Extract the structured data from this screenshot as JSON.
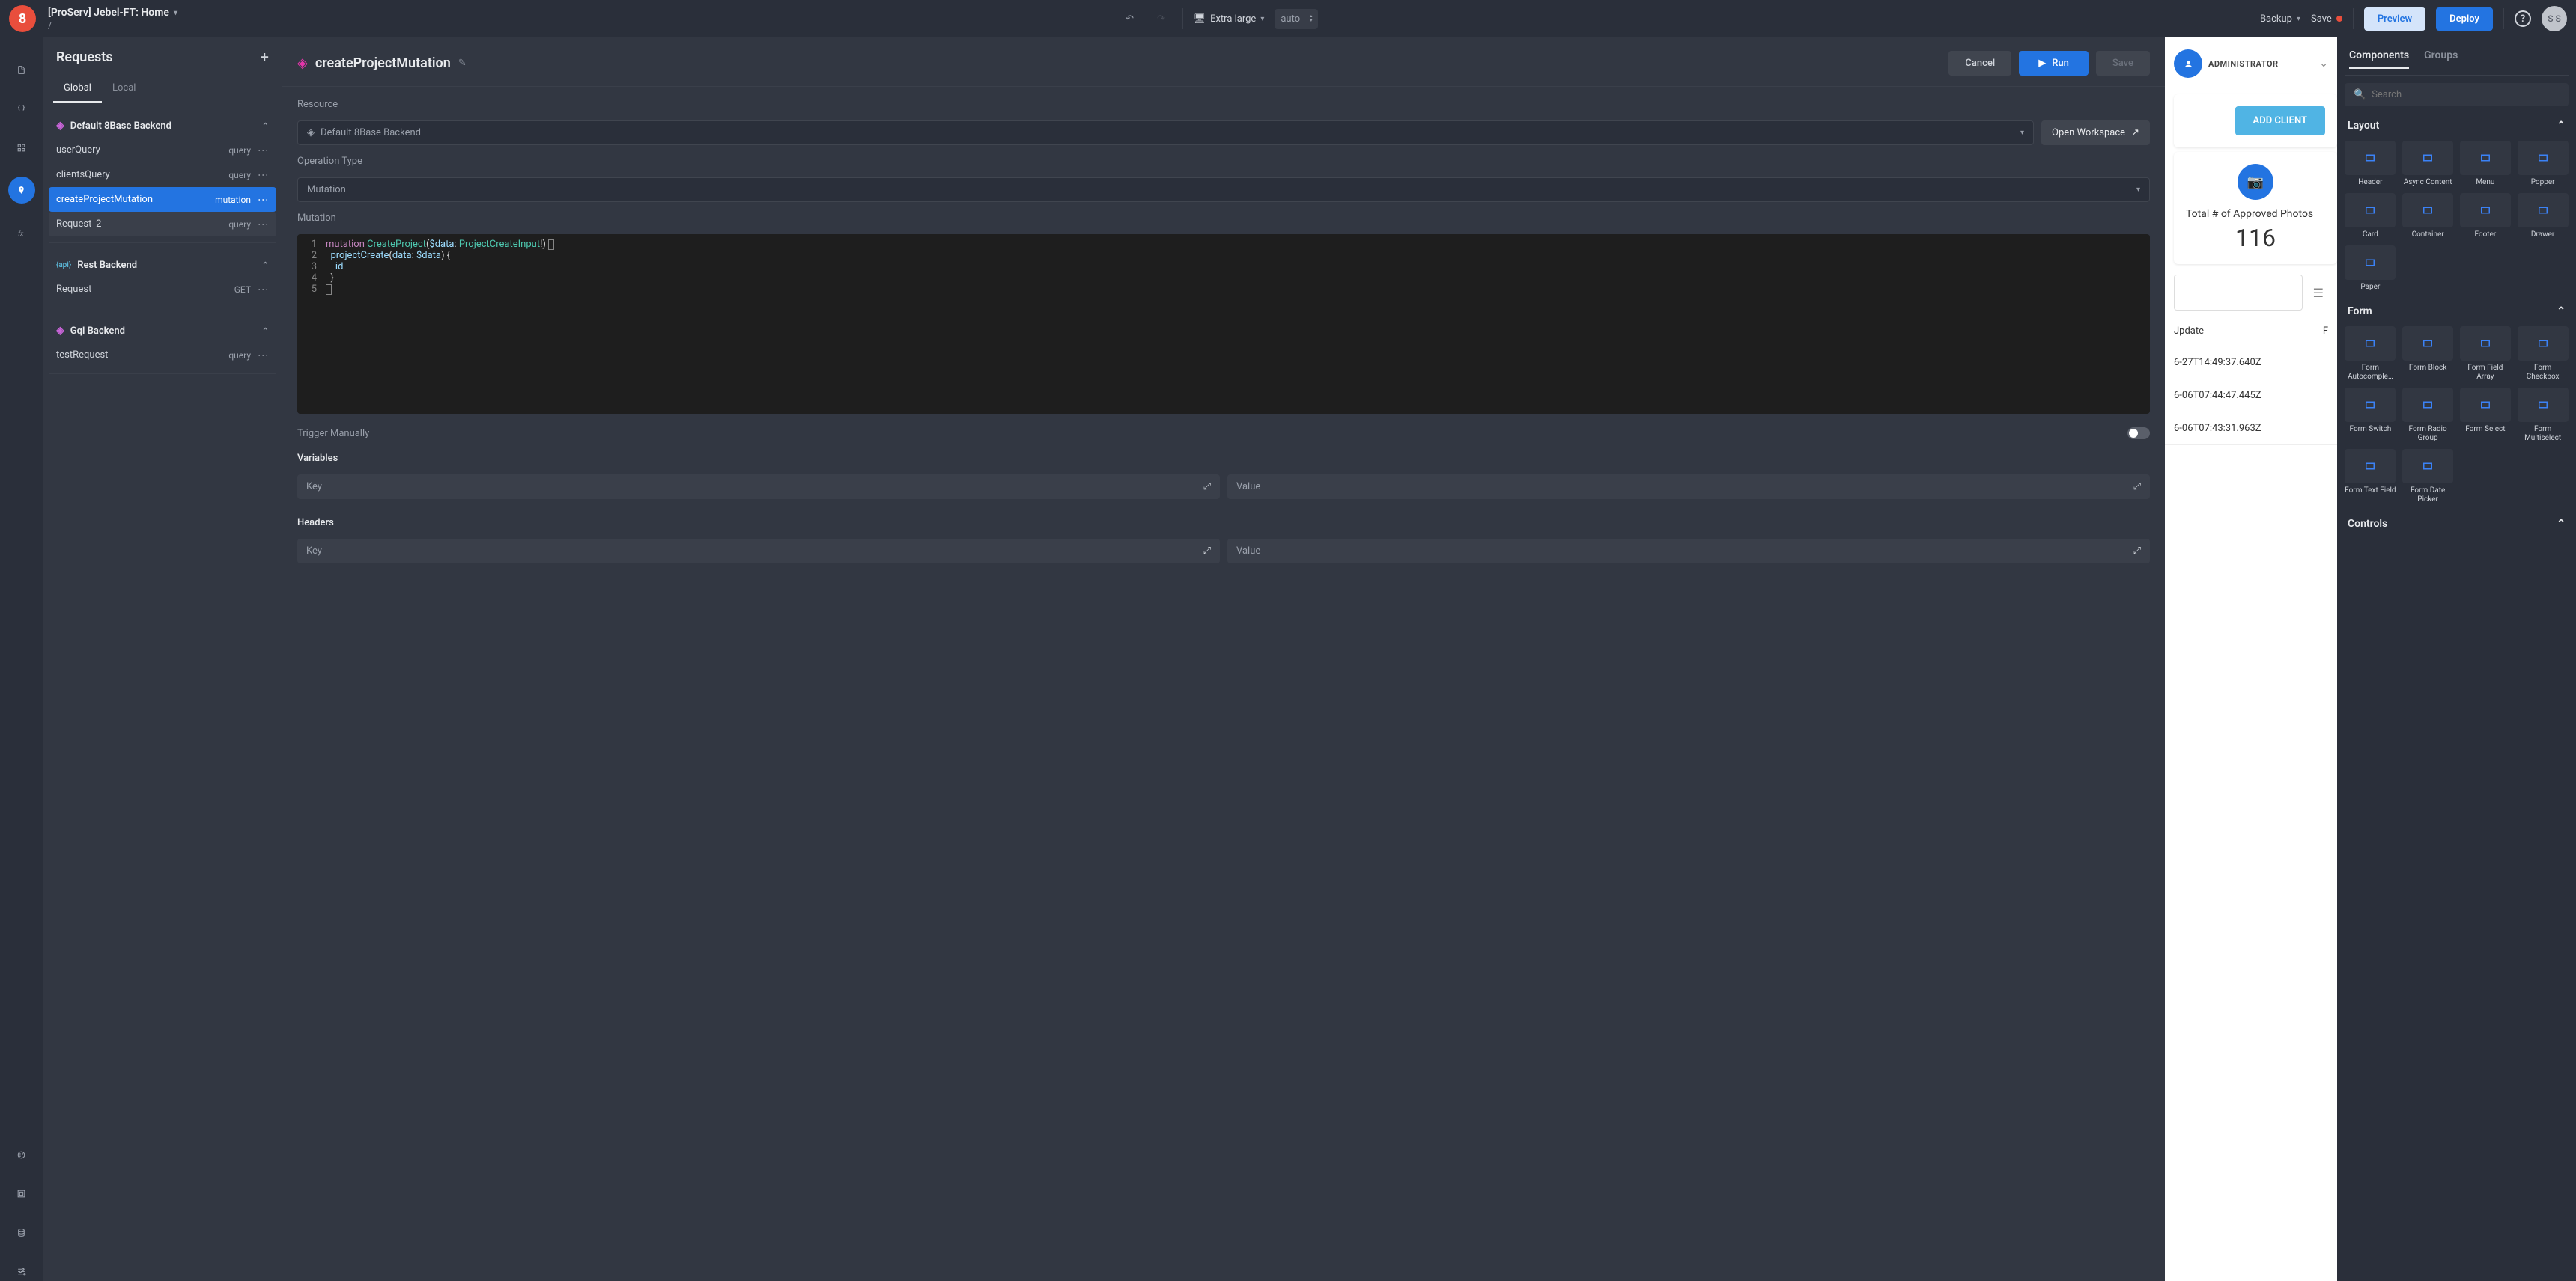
{
  "topbar": {
    "project_name": "[ProServ] Jebel-FT: Home",
    "breadcrumb": "/",
    "viewport_label": "Extra large",
    "auto_label": "auto",
    "backup_label": "Backup",
    "save_label": "Save",
    "preview_label": "Preview",
    "deploy_label": "Deploy",
    "avatar_initials": "S S"
  },
  "requests": {
    "title": "Requests",
    "tabs": {
      "global": "Global",
      "local": "Local"
    },
    "backends": [
      {
        "name": "Default 8Base Backend",
        "icon": "gql",
        "items": [
          {
            "name": "userQuery",
            "type": "query"
          },
          {
            "name": "clientsQuery",
            "type": "query"
          },
          {
            "name": "createProjectMutation",
            "type": "mutation",
            "active": true
          },
          {
            "name": "Request_2",
            "type": "query",
            "hov": true
          }
        ]
      },
      {
        "name": "Rest Backend",
        "icon": "rest",
        "items": [
          {
            "name": "Request",
            "type": "GET"
          }
        ]
      },
      {
        "name": "Gql Backend",
        "icon": "gql",
        "items": [
          {
            "name": "testRequest",
            "type": "query"
          }
        ]
      }
    ]
  },
  "editor": {
    "title": "createProjectMutation",
    "cancel_label": "Cancel",
    "run_label": "Run",
    "save_label": "Save",
    "resource_label": "Resource",
    "resource_value": "Default 8Base Backend",
    "open_workspace_label": "Open Workspace",
    "operation_type_label": "Operation Type",
    "operation_type_value": "Mutation",
    "mutation_label": "Mutation",
    "code_lines": [
      "mutation CreateProject($data: ProjectCreateInput!) {",
      "  projectCreate(data: $data) {",
      "    id",
      "  }",
      "}"
    ],
    "trigger_label": "Trigger Manually",
    "variables_label": "Variables",
    "headers_label": "Headers",
    "key_placeholder": "Key",
    "value_placeholder": "Value"
  },
  "preview": {
    "role": "ADMINISTRATOR",
    "add_client_label": "ADD CLIENT",
    "stat_label": "Total # of Approved Photos",
    "stat_value": "116",
    "col_update": "Jpdate",
    "col_f": "F",
    "rows": [
      "6-27T14:49:37.640Z",
      "6-06T07:44:47.445Z",
      "6-06T07:43:31.963Z"
    ]
  },
  "components": {
    "tab_components": "Components",
    "tab_groups": "Groups",
    "search_placeholder": "Search",
    "sections": {
      "layout": {
        "title": "Layout",
        "items": [
          "Header",
          "Async Content",
          "Menu",
          "Popper",
          "Card",
          "Container",
          "Footer",
          "Drawer",
          "Paper"
        ]
      },
      "form": {
        "title": "Form",
        "items": [
          "Form Autocomple…",
          "Form Block",
          "Form Field Array",
          "Form Checkbox",
          "Form Switch",
          "Form Radio Group",
          "Form Select",
          "Form Multiselect",
          "Form Text Field",
          "Form Date Picker"
        ]
      },
      "controls": {
        "title": "Controls"
      }
    }
  }
}
